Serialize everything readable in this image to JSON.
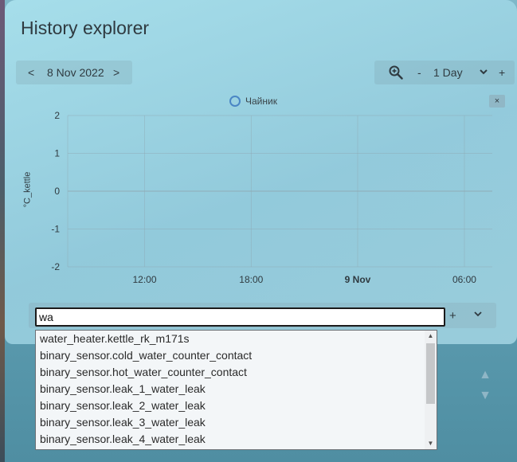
{
  "title": "History explorer",
  "date_nav": {
    "prev": "<",
    "date": "8 Nov 2022",
    "next": ">"
  },
  "range": {
    "zoom_icon": "zoom-icon",
    "minus": "-",
    "value": "1 Day",
    "chevron": "⌄",
    "plus": "+"
  },
  "chart_data": {
    "type": "line",
    "series": [
      {
        "name": "Чайник",
        "values": []
      }
    ],
    "ylabel": "°C_kettle",
    "ylim": [
      -2,
      2
    ],
    "yticks": [
      "2",
      "1",
      "0",
      "-1",
      "-2"
    ],
    "xticks": [
      "12:00",
      "18:00",
      "9 Nov",
      "06:00"
    ],
    "grid": true,
    "legend": "top-center",
    "close_label": "×"
  },
  "search": {
    "value": "wa",
    "add": "+",
    "expand": "⌄"
  },
  "suggestions": [
    "water_heater.kettle_rk_m171s",
    "binary_sensor.cold_water_counter_contact",
    "binary_sensor.hot_water_counter_contact",
    "binary_sensor.leak_1_water_leak",
    "binary_sensor.leak_2_water_leak",
    "binary_sensor.leak_3_water_leak",
    "binary_sensor.leak_4_water_leak"
  ],
  "scroll_arrows": {
    "up": "▲",
    "down": "▼"
  },
  "colors": {
    "accent": "#4a86c5",
    "text": "#2f3a40",
    "grid": "#8fa9b3"
  }
}
